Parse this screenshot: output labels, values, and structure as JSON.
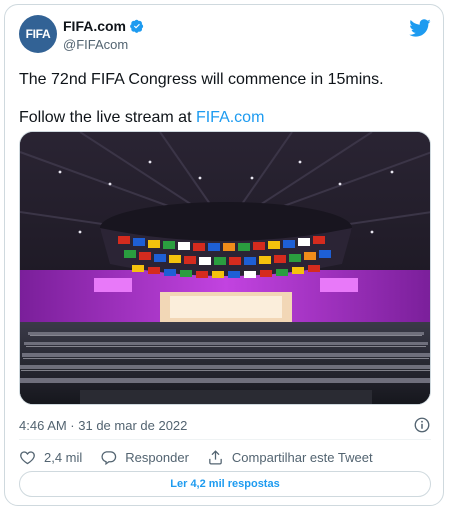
{
  "author": {
    "avatar_text": "FIFA",
    "display_name": "FIFA.com",
    "handle": "@FIFAcom",
    "verified": true
  },
  "tweet": {
    "line1": "The 72nd FIFA Congress will commence in 15mins.",
    "line2_prefix": "Follow the live stream at ",
    "line2_link": "FIFA.com"
  },
  "meta": {
    "timestamp": "4:46 AM · 31 de mar de 2022"
  },
  "actions": {
    "like_count": "2,4 mil",
    "reply_label": "Responder",
    "share_label": "Compartilhar este Tweet"
  },
  "replies_button": "Ler 4,2 mil respostas",
  "colors": {
    "accent": "#1d9bf0",
    "stage_purple": "#b23bd0",
    "avatar_bg": "#326295"
  },
  "icons": [
    "verified-badge-icon",
    "twitter-bird-icon",
    "info-icon",
    "heart-icon",
    "reply-icon",
    "share-icon"
  ]
}
